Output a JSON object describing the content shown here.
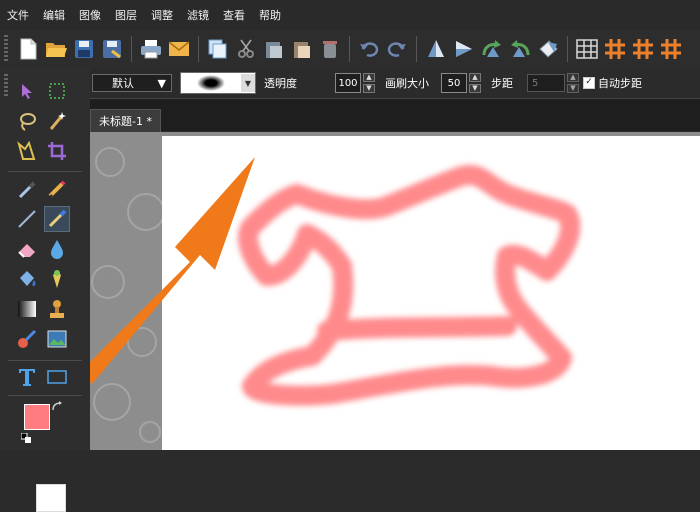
{
  "menu": [
    "文件",
    "编辑",
    "图像",
    "图层",
    "调整",
    "滤镜",
    "查看",
    "帮助"
  ],
  "toolbar": {
    "icons": [
      "new-file-icon",
      "open-folder-icon",
      "save-icon",
      "save-as-icon",
      "print-icon",
      "email-icon",
      "copy-icon",
      "cut-icon",
      "paste-icon",
      "paste-new-icon",
      "clear-icon",
      "undo-icon",
      "redo-icon",
      "flip-vertical-icon",
      "flip-horizontal-icon",
      "rotate-left-icon",
      "rotate-right-icon",
      "rotate-free-icon",
      "grid-icon",
      "grid-snap-icon",
      "grid-settings-icon",
      "grid-extra-icon"
    ]
  },
  "options": {
    "brush_preset": "默认",
    "opacity_label": "透明度",
    "opacity_value": "100",
    "brush_size_label": "画刷大小",
    "brush_size_value": "50",
    "step_label": "步距",
    "step_value": "5",
    "auto_step_label": "自动步距",
    "auto_step_checked": true
  },
  "document": {
    "tab_title": "未标题-1 *"
  },
  "colors": {
    "foreground": "#ff7c80",
    "background": "#ffffff",
    "arrow": "#f07a1a",
    "stroke": "#ff8a8c"
  }
}
